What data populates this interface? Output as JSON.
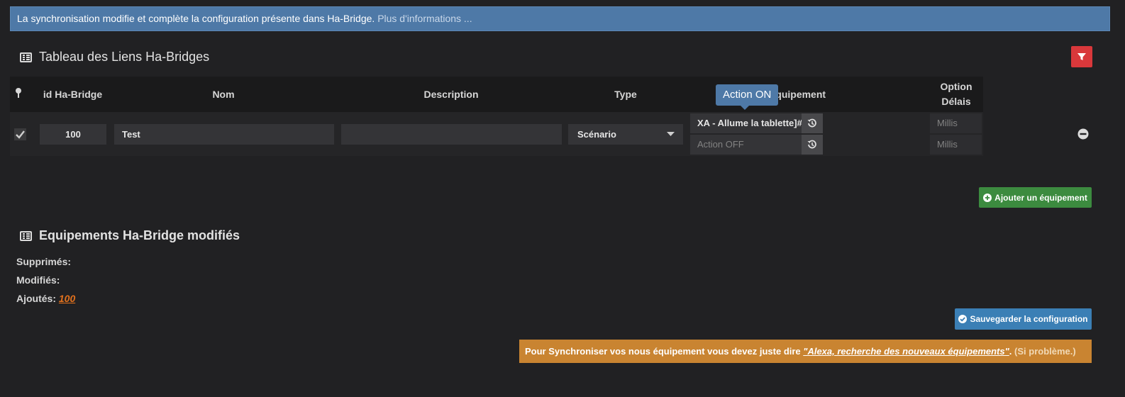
{
  "info_bar": {
    "text": "La synchronisation modifie et complète la configuration présente dans Ha-Bridge.",
    "more_link": "Plus d'informations ..."
  },
  "links_section": {
    "title": "Tableau des Liens Ha-Bridges",
    "filter_icon": "filter-icon"
  },
  "table": {
    "headers": {
      "id": "id Ha-Bridge",
      "name": "Nom",
      "description": "Description",
      "type": "Type",
      "equipment": "Equipement",
      "option_1": "Option",
      "option_2": "Délais"
    },
    "tooltip": "Action ON",
    "rows": [
      {
        "id": "100",
        "name": "Test",
        "description": "",
        "type": "Scénario",
        "action_on": "XA - Allume la tablette]#",
        "action_off_placeholder": "Action OFF",
        "delay_on_placeholder": "Millis",
        "delay_off_placeholder": "Millis"
      }
    ]
  },
  "add_button": "Ajouter un équipement",
  "modified_section": {
    "title": "Equipements Ha-Bridge modifiés",
    "deleted_label": "Supprimés:",
    "modified_label": "Modifiés:",
    "added_label": "Ajoutés:",
    "added_value": "100"
  },
  "save_button": "Sauvegarder la configuration",
  "warning": {
    "prefix": "Pour Synchroniser vos nous équipement vous devez juste dire",
    "quote": "\"Alexa, recherche des nouveaux équipements\"",
    "suffix": ".",
    "help": "(Si problème.)"
  },
  "colors": {
    "background": "#212123",
    "info": "#4e79a7",
    "danger": "#d9383b",
    "success": "#3c8b3f",
    "primary": "#3b7fb5",
    "warning": "#c98431",
    "link": "#e2711d"
  }
}
